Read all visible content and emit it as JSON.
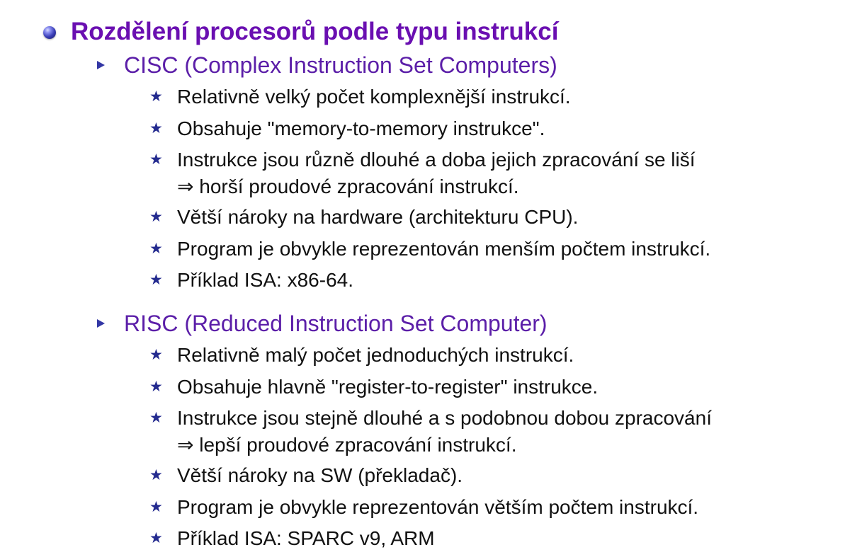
{
  "title": "Rozdělení procesorů podle typu instrukcí",
  "sections": [
    {
      "heading": "CISC (Complex Instruction Set Computers)",
      "items": [
        "Relativně velký počet komplexnější instrukcí.",
        "Obsahuje \"memory-to-memory instrukce\".",
        "Instrukce jsou různě dlouhé a doba jejich zpracování se liší",
        "⇒ horší proudové zpracování instrukcí.",
        "Větší nároky na hardware (architekturu CPU).",
        "Program je obvykle reprezentován menším počtem instrukcí.",
        "Příklad ISA: x86-64."
      ]
    },
    {
      "heading": "RISC (Reduced Instruction Set Computer)",
      "items": [
        "Relativně malý počet jednoduchých instrukcí.",
        "Obsahuje hlavně \"register-to-register\" instrukce.",
        "Instrukce jsou stejně dlouhé a s podobnou dobou zpracování",
        "⇒ lepší proudové zpracování instrukcí.",
        "Větší nároky na SW (překladač).",
        "Program je obvykle reprezentován větším počtem instrukcí.",
        "Příklad ISA: SPARC v9, ARM"
      ]
    }
  ],
  "glyphs": {
    "star": "★"
  }
}
